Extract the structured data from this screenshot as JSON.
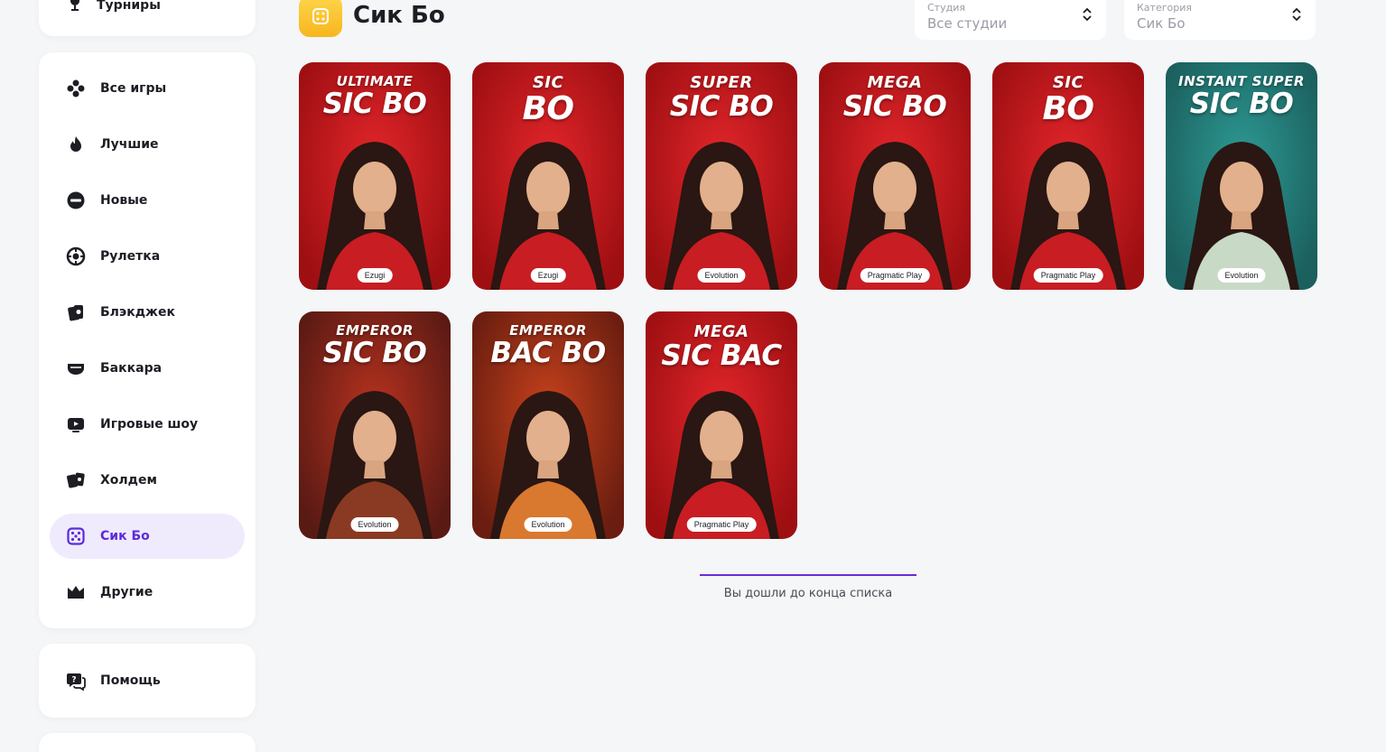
{
  "sidebar": {
    "tournaments_label": "Турниры",
    "items": [
      {
        "label": "Все игры",
        "icon": "clubs-icon"
      },
      {
        "label": "Лучшие",
        "icon": "fire-icon"
      },
      {
        "label": "Новые",
        "icon": "new-badge-icon"
      },
      {
        "label": "Рулетка",
        "icon": "roulette-icon"
      },
      {
        "label": "Блэкджек",
        "icon": "cards-icon"
      },
      {
        "label": "Баккара",
        "icon": "baccarat-icon"
      },
      {
        "label": "Игровые шоу",
        "icon": "tv-icon"
      },
      {
        "label": "Холдем",
        "icon": "poker-cards-icon"
      },
      {
        "label": "Сик Бо",
        "icon": "dice-icon"
      },
      {
        "label": "Другие",
        "icon": "crown-icon"
      }
    ],
    "active_item": "Сик Бо",
    "help_label": "Помощь"
  },
  "header": {
    "title": "Сик Бо",
    "icon": "dice-icon"
  },
  "filters": {
    "studio": {
      "caption": "Студия",
      "value": "Все студии"
    },
    "category": {
      "caption": "Категория",
      "value": "Сик Бо"
    }
  },
  "games": [
    {
      "line1": "ULTIMATE",
      "line2": "SIC BO",
      "provider": "Ezugi",
      "theme": "red"
    },
    {
      "line1": "SIC",
      "line2": "BO",
      "provider": "Ezugi",
      "theme": "red"
    },
    {
      "line1": "SUPER",
      "line2": "SIC BO",
      "provider": "Evolution",
      "theme": "red"
    },
    {
      "line1": "MEGA",
      "line2": "SIC BO",
      "provider": "Pragmatic Play",
      "theme": "red"
    },
    {
      "line1": "SIC",
      "line2": "BO",
      "provider": "Pragmatic Play",
      "theme": "red"
    },
    {
      "line1": "INSTANT SUPER",
      "line2": "SIC BO",
      "provider": "Evolution",
      "theme": "teal"
    },
    {
      "line1": "EMPEROR",
      "line2": "SIC BO",
      "provider": "Evolution",
      "theme": "darkred"
    },
    {
      "line1": "EMPEROR",
      "line2": "BAC BO",
      "provider": "Evolution",
      "theme": "orange"
    },
    {
      "line1": "MEGA",
      "line2": "SIC BAC",
      "provider": "Pragmatic Play",
      "theme": "red"
    }
  ],
  "end_of_list": "Вы дошли до конца списка",
  "colors": {
    "accent": "#6b2bd6",
    "active_bg": "#f0eafd",
    "header_icon": "#f7b61e"
  }
}
